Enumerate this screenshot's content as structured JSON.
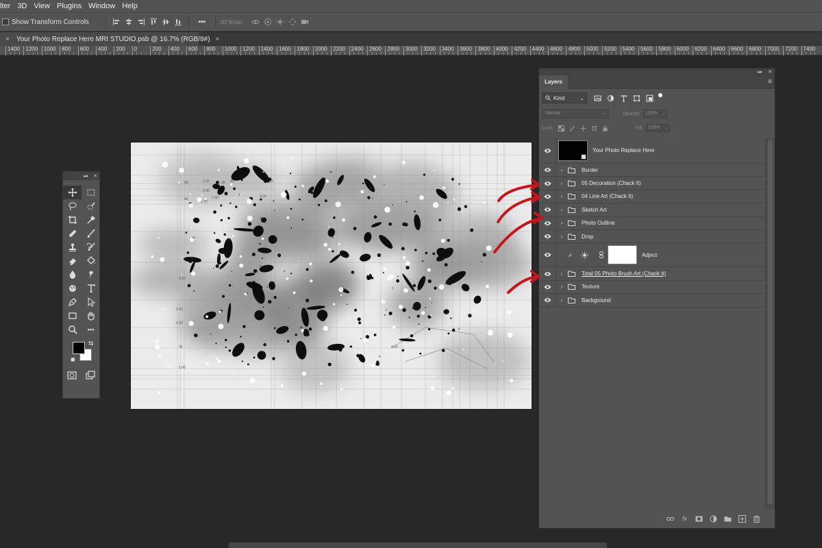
{
  "menu": [
    "lter",
    "3D",
    "View",
    "Plugins",
    "Window",
    "Help"
  ],
  "options": {
    "show_transform": "Show Transform Controls",
    "more": "•••",
    "mode_3d": "3D Mode:"
  },
  "tab": {
    "title": "Your Photo Replace Here MRI STUDIO.psb @ 16.7% (RGB/8#)",
    "close": "×"
  },
  "ruler": [
    "1400",
    "1200",
    "1000",
    "800",
    "600",
    "400",
    "200",
    "0",
    "200",
    "400",
    "600",
    "800",
    "1000",
    "1200",
    "1400",
    "1600",
    "1800",
    "2000",
    "2200",
    "2400",
    "2600",
    "2800",
    "3000",
    "3200",
    "3400",
    "3600",
    "3800",
    "4000",
    "4200",
    "4400",
    "4600",
    "4800",
    "5000",
    "5200",
    "5400",
    "5600",
    "5800",
    "6000",
    "6200",
    "6400",
    "6600",
    "6800",
    "7000",
    "7200",
    "7400"
  ],
  "canvas_labels": [
    "40",
    "1.50",
    "39",
    "42",
    "3.25",
    "2.30",
    "40",
    "2.30",
    "3.20",
    "2.70",
    "4.20",
    "3.20",
    "4.20",
    "35",
    "4.50",
    "1.00"
  ],
  "toolbox": {
    "collapse": "◂◂",
    "close": "✕",
    "swap": "⇆",
    "default": "◼"
  },
  "layers_panel": {
    "collapse": "◂◂",
    "close": "✕",
    "tab": "Layers",
    "menu": "≡",
    "kind": "Kind",
    "caret": "⌄",
    "blend": "Normal",
    "opacity_label": "Opacity:",
    "opacity": "100%",
    "lock_label": "Lock:",
    "fill_label": "Fill:",
    "fill": "100%",
    "layers": [
      {
        "name": "Your Photo Replace Here"
      },
      {
        "name": "Border"
      },
      {
        "name": "05 Decoration (Chack It)"
      },
      {
        "name": "04 Line Art (Chack It)"
      },
      {
        "name": "Sketch Art"
      },
      {
        "name": "Photo Outline"
      },
      {
        "name": "Drop"
      },
      {
        "name": "Adject"
      },
      {
        "name": "Total 05 Photo Brush Art (Chack It)"
      },
      {
        "name": "Texture"
      },
      {
        "name": "Background"
      }
    ],
    "fx": "fx"
  },
  "colors": {
    "chrome": "#535353",
    "workspace": "#282828",
    "arrow_red": "#c4161c"
  }
}
